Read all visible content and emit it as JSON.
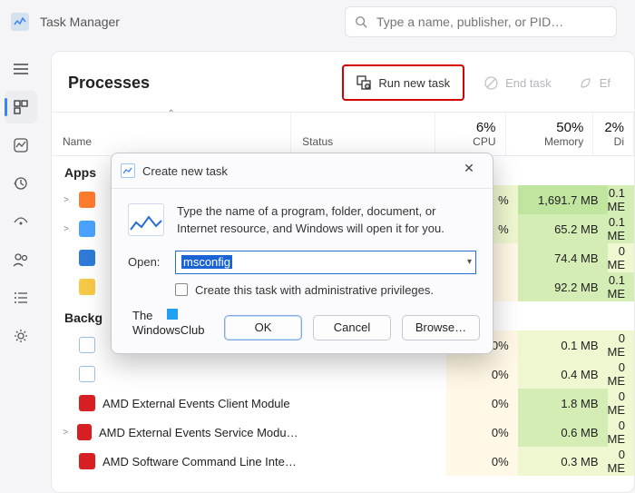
{
  "app": {
    "title": "Task Manager"
  },
  "search": {
    "placeholder": "Type a name, publisher, or PID…"
  },
  "page": {
    "title": "Processes"
  },
  "toolbar": {
    "run_new_task": "Run new task",
    "end_task": "End task",
    "efficiency": "Ef"
  },
  "columns": {
    "name": "Name",
    "status": "Status",
    "cpu_pct": "6%",
    "cpu_lbl": "CPU",
    "mem_pct": "50%",
    "mem_lbl": "Memory",
    "disk_pct": "2%",
    "disk_lbl": "Di"
  },
  "groups": {
    "apps": "Apps",
    "background": "Backg"
  },
  "rows": [
    {
      "expand": true,
      "icon_bg": "#ff7b2e",
      "name": "",
      "cpu": "%",
      "mem": "1,691.7 MB",
      "disk": "0.1 ME",
      "cpu_cls": "heat-md",
      "mem_cls": "heat-vhi",
      "disk_cls": "heat-hi"
    },
    {
      "expand": true,
      "icon_bg": "#4aa3ff",
      "name": "",
      "cpu": "%",
      "mem": "65.2 MB",
      "disk": "0.1 ME",
      "cpu_cls": "heat-md",
      "mem_cls": "heat-hi",
      "disk_cls": "heat-hi"
    },
    {
      "expand": false,
      "icon_bg": "#2e7bd9",
      "name": "",
      "cpu": "",
      "mem": "74.4 MB",
      "disk": "0 ME",
      "cpu_cls": "heat-lo",
      "mem_cls": "heat-hi",
      "disk_cls": "heat-md"
    },
    {
      "expand": false,
      "icon_bg": "#f7c948",
      "name": "",
      "cpu": "",
      "mem": "92.2 MB",
      "disk": "0.1 ME",
      "cpu_cls": "heat-lo",
      "mem_cls": "heat-hi",
      "disk_cls": "heat-hi"
    }
  ],
  "bg_rows": [
    {
      "expand": false,
      "icon_bg": "#ffffff",
      "icon_border": "#9cc0e8",
      "name": "",
      "cpu": "0%",
      "mem": "0.1 MB",
      "disk": "0 ME",
      "cpu_cls": "heat-lo",
      "mem_cls": "heat-md",
      "disk_cls": "heat-md"
    },
    {
      "expand": false,
      "icon_bg": "#ffffff",
      "icon_border": "#9cc0e8",
      "name": "",
      "cpu": "0%",
      "mem": "0.4 MB",
      "disk": "0 ME",
      "cpu_cls": "heat-lo",
      "mem_cls": "heat-md",
      "disk_cls": "heat-md"
    },
    {
      "expand": false,
      "icon_bg": "#d71e22",
      "name": "AMD External Events Client Module",
      "cpu": "0%",
      "mem": "1.8 MB",
      "disk": "0 ME",
      "cpu_cls": "heat-lo",
      "mem_cls": "heat-hi",
      "disk_cls": "heat-md"
    },
    {
      "expand": true,
      "icon_bg": "#d71e22",
      "name": "AMD External Events Service Modu…",
      "cpu": "0%",
      "mem": "0.6 MB",
      "disk": "0 ME",
      "cpu_cls": "heat-lo",
      "mem_cls": "heat-hi",
      "disk_cls": "heat-md"
    },
    {
      "expand": false,
      "icon_bg": "#d71e22",
      "name": "AMD Software Command Line Inte…",
      "cpu": "0%",
      "mem": "0.3 MB",
      "disk": "0 ME",
      "cpu_cls": "heat-lo",
      "mem_cls": "heat-md",
      "disk_cls": "heat-md"
    }
  ],
  "dialog": {
    "title": "Create new task",
    "intro": "Type the name of a program, folder, document, or Internet resource, and Windows will open it for you.",
    "open_label": "Open:",
    "open_value": "msconfig",
    "admin_label": "Create this task with administrative privileges.",
    "ok": "OK",
    "cancel": "Cancel",
    "browse": "Browse…"
  },
  "watermark": {
    "line1": "The",
    "line2": "WindowsClub"
  }
}
